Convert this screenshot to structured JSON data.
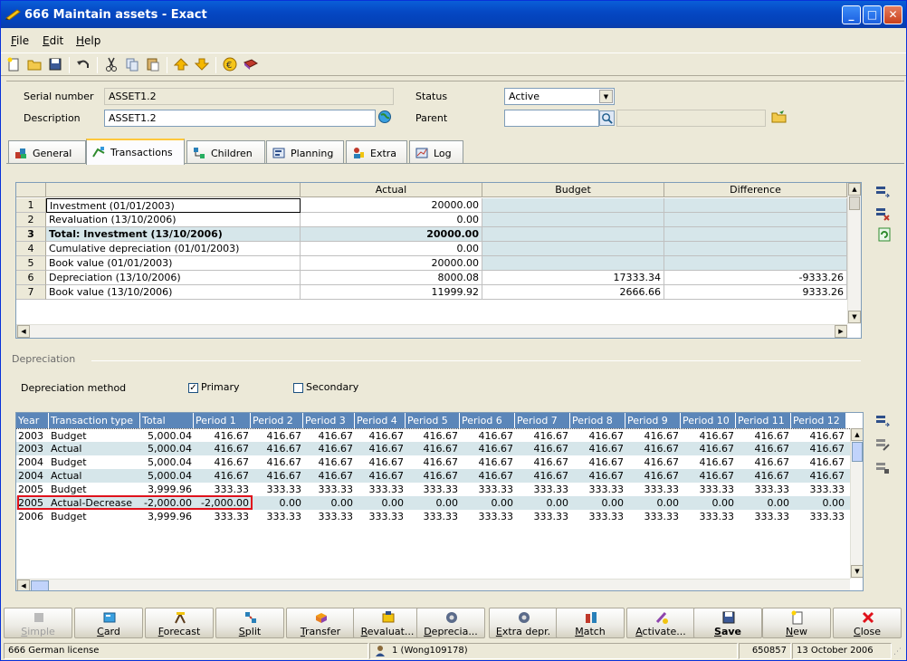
{
  "window": {
    "title": "666 Maintain assets - Exact",
    "minimize": "_",
    "maximize": "□",
    "close": "✕"
  },
  "menu": [
    {
      "key": "F",
      "rest": "ile"
    },
    {
      "key": "E",
      "rest": "dit"
    },
    {
      "key": "H",
      "rest": "elp"
    }
  ],
  "header": {
    "serial_label": "Serial number",
    "serial_value": "ASSET1.2",
    "description_label": "Description",
    "description_value": "ASSET1.2",
    "status_label": "Status",
    "status_value": "Active",
    "parent_label": "Parent",
    "parent_value": ""
  },
  "tabs": [
    {
      "label": "General"
    },
    {
      "label": "Transactions"
    },
    {
      "label": "Children"
    },
    {
      "label": "Planning"
    },
    {
      "label": "Extra"
    },
    {
      "label": "Log"
    }
  ],
  "transactions_grid": {
    "headers": [
      "Actual",
      "Budget",
      "Difference"
    ],
    "rows": [
      {
        "n": "1",
        "desc": "Investment (01/01/2003)",
        "actual": "20000.00",
        "budget": "",
        "diff": ""
      },
      {
        "n": "2",
        "desc": "Revaluation (13/10/2006)",
        "actual": "0.00",
        "budget": "",
        "diff": ""
      },
      {
        "n": "3",
        "desc": "Total: Investment (13/10/2006)",
        "actual": "20000.00",
        "budget": "",
        "diff": ""
      },
      {
        "n": "4",
        "desc": "Cumulative depreciation (01/01/2003)",
        "actual": "0.00",
        "budget": "",
        "diff": ""
      },
      {
        "n": "5",
        "desc": "Book value (01/01/2003)",
        "actual": "20000.00",
        "budget": "",
        "diff": ""
      },
      {
        "n": "6",
        "desc": "Depreciation (13/10/2006)",
        "actual": "8000.08",
        "budget": "17333.34",
        "diff": "-9333.26"
      },
      {
        "n": "7",
        "desc": "Book value (13/10/2006)",
        "actual": "11999.92",
        "budget": "2666.66",
        "diff": "9333.26"
      }
    ]
  },
  "depreciation": {
    "section_label": "Depreciation",
    "method_label": "Depreciation method",
    "primary_label": "Primary",
    "primary_checked": true,
    "secondary_label": "Secondary",
    "secondary_checked": false,
    "headers": [
      "Year",
      "Transaction type",
      "Total",
      "Period 1",
      "Period 2",
      "Period 3",
      "Period 4",
      "Period 5",
      "Period 6",
      "Period 7",
      "Period 8",
      "Period 9",
      "Period 10",
      "Period 11",
      "Period 12"
    ],
    "rows": [
      [
        "2003",
        "Budget",
        "5,000.04",
        "416.67",
        "416.67",
        "416.67",
        "416.67",
        "416.67",
        "416.67",
        "416.67",
        "416.67",
        "416.67",
        "416.67",
        "416.67",
        "416.67"
      ],
      [
        "2003",
        "Actual",
        "5,000.04",
        "416.67",
        "416.67",
        "416.67",
        "416.67",
        "416.67",
        "416.67",
        "416.67",
        "416.67",
        "416.67",
        "416.67",
        "416.67",
        "416.67"
      ],
      [
        "2004",
        "Budget",
        "5,000.04",
        "416.67",
        "416.67",
        "416.67",
        "416.67",
        "416.67",
        "416.67",
        "416.67",
        "416.67",
        "416.67",
        "416.67",
        "416.67",
        "416.67"
      ],
      [
        "2004",
        "Actual",
        "5,000.04",
        "416.67",
        "416.67",
        "416.67",
        "416.67",
        "416.67",
        "416.67",
        "416.67",
        "416.67",
        "416.67",
        "416.67",
        "416.67",
        "416.67"
      ],
      [
        "2005",
        "Budget",
        "3,999.96",
        "333.33",
        "333.33",
        "333.33",
        "333.33",
        "333.33",
        "333.33",
        "333.33",
        "333.33",
        "333.33",
        "333.33",
        "333.33",
        "333.33"
      ],
      [
        "2005",
        "Actual-Decrease",
        "-2,000.00",
        "-2,000.00",
        "0.00",
        "0.00",
        "0.00",
        "0.00",
        "0.00",
        "0.00",
        "0.00",
        "0.00",
        "0.00",
        "0.00",
        "0.00"
      ],
      [
        "2006",
        "Budget",
        "3,999.96",
        "333.33",
        "333.33",
        "333.33",
        "333.33",
        "333.33",
        "333.33",
        "333.33",
        "333.33",
        "333.33",
        "333.33",
        "333.33",
        "333.33"
      ]
    ]
  },
  "buttons": [
    {
      "key": "S",
      "rest": "imple",
      "disabled": true
    },
    {
      "key": "C",
      "rest": "ard"
    },
    {
      "key": "F",
      "rest": "orecast"
    },
    {
      "key": "S",
      "rest": "plit"
    },
    {
      "key": "T",
      "rest": "ransfer"
    },
    {
      "key": "R",
      "rest": "evaluat..."
    },
    {
      "key": "D",
      "rest": "eprecia..."
    },
    {
      "key": "E",
      "rest": "xtra depr."
    },
    {
      "key": "M",
      "rest": "atch"
    },
    {
      "key": "A",
      "rest": "ctivate..."
    },
    {
      "key": "S",
      "rest": "ave",
      "bold": true
    },
    {
      "key": "N",
      "rest": "ew"
    },
    {
      "key": "C",
      "rest": "lose"
    }
  ],
  "statusbar": {
    "license": "666 German license",
    "user": "1 (Wong109178)",
    "code": "650857",
    "date": "13 October 2006"
  },
  "colors": {
    "title_bar": "#0548c4",
    "grid_header": "#5b86b9",
    "row_shade": "#d6e6ea",
    "highlight_border": "#e0121b"
  }
}
